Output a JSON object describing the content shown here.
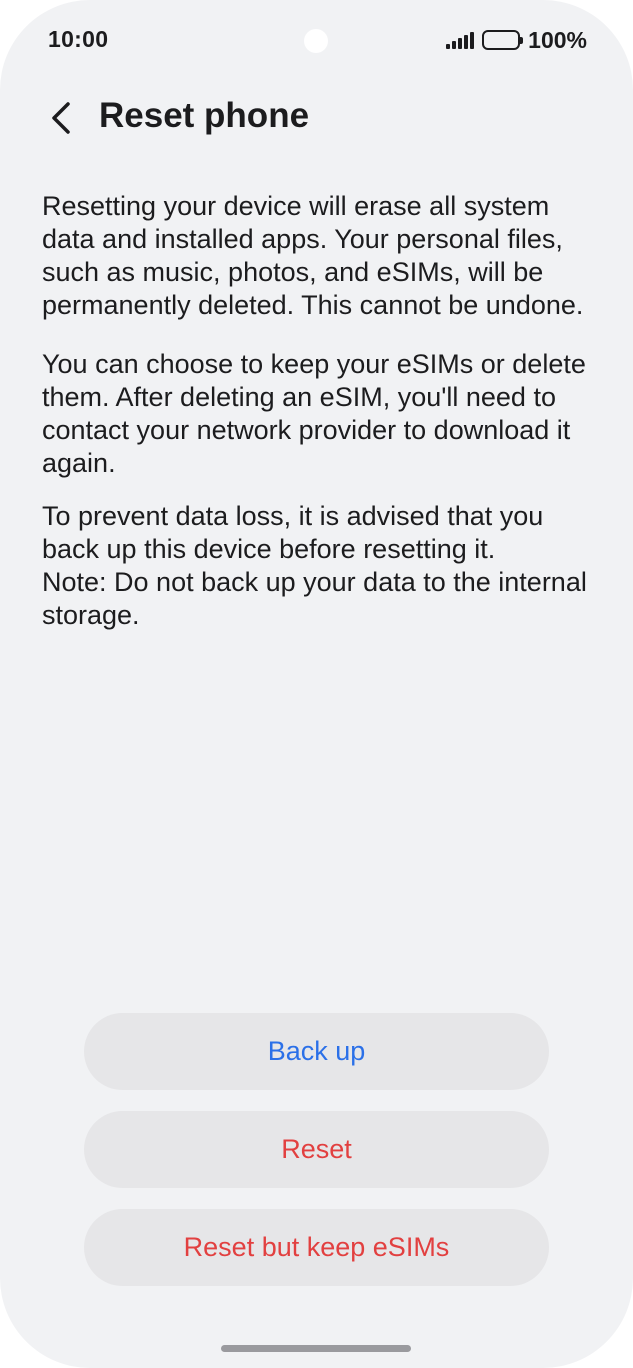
{
  "status_bar": {
    "time": "10:00",
    "battery": "100%",
    "icons": [
      "signal-icon",
      "battery-icon"
    ]
  },
  "header": {
    "title": "Reset phone",
    "back_icon": "chevron-left-icon"
  },
  "content": {
    "paragraph_1": "Resetting your device will erase all system data and installed apps. Your personal files, such as music, photos, and eSIMs, will be permanently deleted. This cannot be undone.",
    "paragraph_2": "You can choose to keep your eSIMs or delete them. After deleting an eSIM, you'll need to contact your network provider to download it again.",
    "paragraph_3": "To prevent data loss, it is advised that you back up this device before resetting it.",
    "paragraph_4": "Note: Do not back up your data to the internal storage."
  },
  "actions": {
    "back_up_label": "Back up",
    "reset_label": "Reset",
    "reset_keep_esims_label": "Reset but keep eSIMs"
  },
  "colors": {
    "background": "#f1f2f4",
    "button_background": "#e6e6e8",
    "primary_blue": "#2b70e8",
    "destructive_red": "#e24040",
    "text": "#1c1c1e"
  }
}
